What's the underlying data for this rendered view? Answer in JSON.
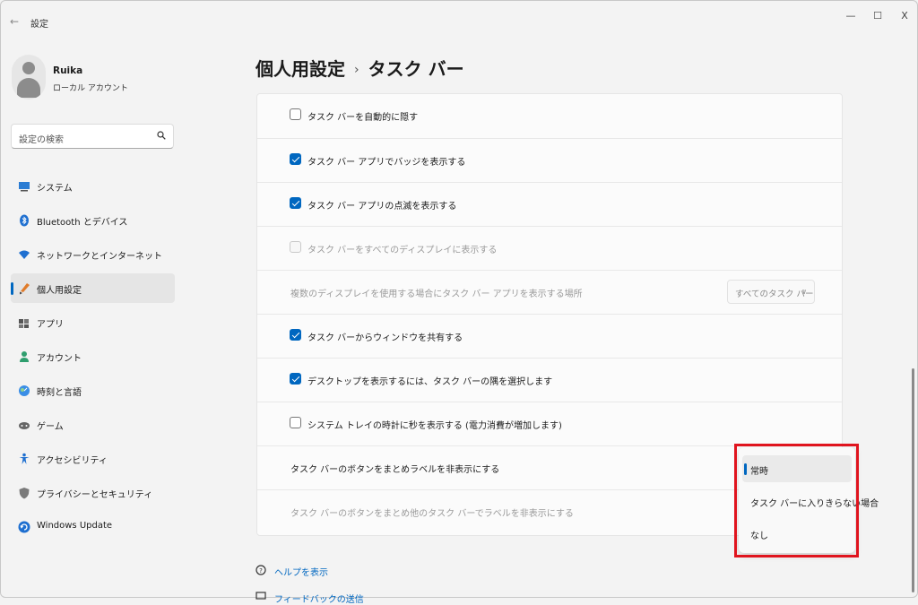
{
  "window": {
    "title": "設定",
    "minimize": "—",
    "maximize": "☐",
    "close": "X"
  },
  "user": {
    "name": "Ruika",
    "account_type": "ローカル アカウント"
  },
  "search": {
    "placeholder": "設定の検索"
  },
  "sidebar": {
    "items": [
      {
        "label": "システム",
        "icon": "system-icon"
      },
      {
        "label": "Bluetooth とデバイス",
        "icon": "bluetooth-icon"
      },
      {
        "label": "ネットワークとインターネット",
        "icon": "wifi-icon"
      },
      {
        "label": "個人用設定",
        "icon": "brush-icon",
        "active": true
      },
      {
        "label": "アプリ",
        "icon": "apps-icon"
      },
      {
        "label": "アカウント",
        "icon": "account-icon"
      },
      {
        "label": "時刻と言語",
        "icon": "time-language-icon"
      },
      {
        "label": "ゲーム",
        "icon": "gamepad-icon"
      },
      {
        "label": "アクセシビリティ",
        "icon": "accessibility-icon"
      },
      {
        "label": "プライバシーとセキュリティ",
        "icon": "shield-icon"
      },
      {
        "label": "Windows Update",
        "icon": "update-icon"
      }
    ]
  },
  "breadcrumb": {
    "parent": "個人用設定",
    "separator": "›",
    "current": "タスク バー"
  },
  "settings": {
    "rows": [
      {
        "type": "checkbox",
        "label": "タスク バーを自動的に隠す",
        "checked": false,
        "disabled": false
      },
      {
        "type": "checkbox",
        "label": "タスク バー アプリでバッジを表示する",
        "checked": true,
        "disabled": false
      },
      {
        "type": "checkbox",
        "label": "タスク バー アプリの点滅を表示する",
        "checked": true,
        "disabled": false
      },
      {
        "type": "checkbox",
        "label": "タスク バーをすべてのディスプレイに表示する",
        "checked": false,
        "disabled": true
      },
      {
        "type": "dropdown",
        "label": "複数のディスプレイを使用する場合にタスク バー アプリを表示する場所",
        "value": "すべてのタスク バー",
        "disabled": true
      },
      {
        "type": "checkbox",
        "label": "タスク バーからウィンドウを共有する",
        "checked": true,
        "disabled": false
      },
      {
        "type": "checkbox",
        "label": "デスクトップを表示するには、タスク バーの隅を選択します",
        "checked": true,
        "disabled": false
      },
      {
        "type": "checkbox",
        "label": "システム トレイの時計に秒を表示する (電力消費が増加します)",
        "checked": false,
        "disabled": false
      },
      {
        "type": "dropdown",
        "label": "タスク バーのボタンをまとめラベルを非表示にする",
        "disabled": false
      },
      {
        "type": "dropdown",
        "label": "タスク バーのボタンをまとめ他のタスク バーでラベルを非表示にする",
        "disabled": true
      }
    ]
  },
  "dropdown_menu": {
    "options": [
      "常時",
      "タスク バーに入りきらない場合",
      "なし"
    ],
    "selected": "常時",
    "highlight_color": "#e0141e"
  },
  "links": {
    "help": "ヘルプを表示",
    "feedback": "フィードバックの送信"
  },
  "colors": {
    "accent": "#0067c0",
    "background": "#f3f3f3",
    "card": "#fbfbfb"
  }
}
